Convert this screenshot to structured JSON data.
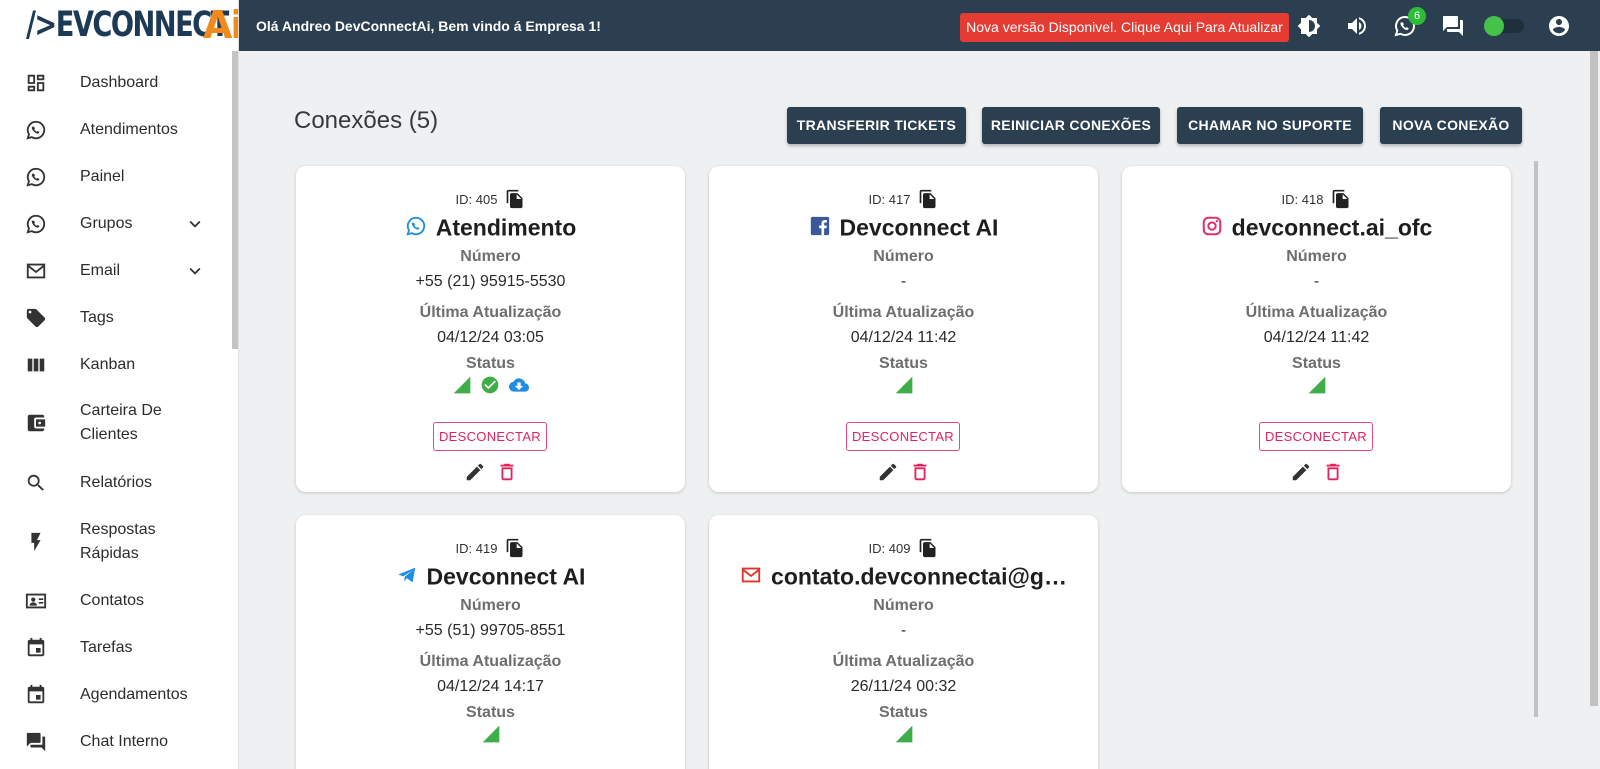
{
  "app": {
    "logo_text": "/>EVCONNECT",
    "logo_accent": "Ai",
    "greeting": "Olá Andreo DevConnectAi, Bem vindo á Empresa 1!",
    "update_banner": "Nova versão Disponivel. Clique Aqui Para Atualizar",
    "whatsapp_badge": "6",
    "colors": {
      "topbar": "#2b3f50",
      "update": "#e43c33",
      "accent_orange": "#f08a1c",
      "disconnect": "#e0245b",
      "status_green": "#3fae49"
    }
  },
  "sidebar": {
    "items": [
      {
        "label": "Dashboard",
        "icon": "dashboard-icon"
      },
      {
        "label": "Atendimentos",
        "icon": "whatsapp-icon"
      },
      {
        "label": "Painel",
        "icon": "whatsapp-icon"
      },
      {
        "label": "Grupos",
        "icon": "whatsapp-icon",
        "expandable": true
      },
      {
        "label": "Email",
        "icon": "mail-icon",
        "expandable": true
      },
      {
        "label": "Tags",
        "icon": "tag-icon"
      },
      {
        "label": "Kanban",
        "icon": "kanban-icon"
      },
      {
        "label": "Carteira De Clientes",
        "icon": "wallet-icon"
      },
      {
        "label": "Relatórios",
        "icon": "search-icon"
      },
      {
        "label": "Respostas Rápidas",
        "icon": "bolt-icon"
      },
      {
        "label": "Contatos",
        "icon": "contacts-icon"
      },
      {
        "label": "Tarefas",
        "icon": "calendar-icon"
      },
      {
        "label": "Agendamentos",
        "icon": "calendar-icon"
      },
      {
        "label": "Chat Interno",
        "icon": "chat-icon"
      }
    ]
  },
  "main": {
    "title": "Conexões (5)",
    "buttons": {
      "transfer": "TRANSFERIR TICKETS",
      "restart": "REINICIAR CONEXÕES",
      "support": "CHAMAR NO SUPORTE",
      "new": "NOVA CONEXÃO"
    },
    "labels": {
      "number": "Número",
      "last_update": "Última Atualização",
      "status": "Status",
      "disconnect": "DESCONECTAR"
    },
    "cards": [
      {
        "id": "ID: 405",
        "channel": "whatsapp",
        "name": "Atendimento",
        "number": "+55 (21) 95915-5530",
        "updated": "04/12/24 03:05"
      },
      {
        "id": "ID: 417",
        "channel": "facebook",
        "name": "Devconnect AI",
        "number": "-",
        "updated": "04/12/24 11:42"
      },
      {
        "id": "ID: 418",
        "channel": "instagram",
        "name": "devconnect.ai_ofc",
        "number": "-",
        "updated": "04/12/24 11:42"
      },
      {
        "id": "ID: 419",
        "channel": "telegram",
        "name": "Devconnect AI",
        "number": "+55 (51) 99705-8551",
        "updated": "04/12/24 14:17"
      },
      {
        "id": "ID: 409",
        "channel": "email",
        "name": "contato.devconnectai@g…",
        "number": "-",
        "updated": "26/11/24 00:32"
      }
    ]
  }
}
